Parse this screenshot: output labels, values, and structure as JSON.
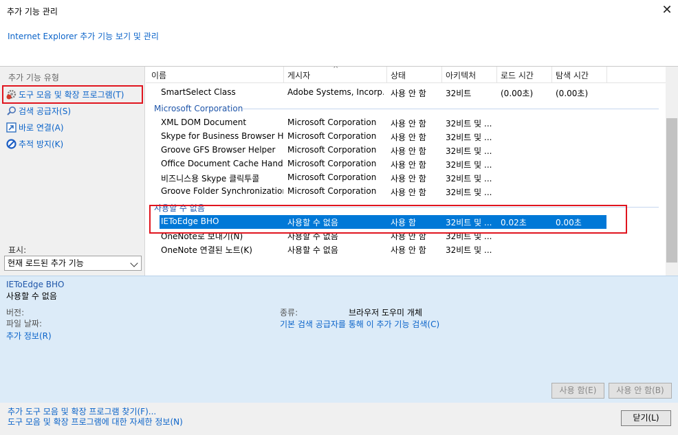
{
  "window": {
    "title": "추가 기능 관리",
    "subtitle": "Internet Explorer 추가 기능 보기 및 관리"
  },
  "left_pane": {
    "types_label": "추가 기능 유형",
    "items": [
      {
        "label": "도구 모음 및 확장 프로그램(T)",
        "icon": "gear-icon"
      },
      {
        "label": "검색 공급자(S)",
        "icon": "search-icon"
      },
      {
        "label": "바로 연결(A)",
        "icon": "accelerator-icon"
      },
      {
        "label": "추적 방지(K)",
        "icon": "block-icon"
      }
    ],
    "show_label": "표시:",
    "show_value": "현재 로드된 추가 기능"
  },
  "list": {
    "columns": [
      "이름",
      "게시자",
      "상태",
      "아키텍처",
      "로드 시간",
      "탐색 시간"
    ],
    "top_row": {
      "name": "SmartSelect Class",
      "publisher": "Adobe Systems, Incorp...",
      "status": "사용 안 함",
      "arch": "32비트",
      "load": "(0.00초)",
      "nav": "(0.00초)"
    },
    "group1": "Microsoft Corporation",
    "group1_rows": [
      {
        "name": "XML DOM Document",
        "publisher": "Microsoft Corporation",
        "status": "사용 안 함",
        "arch": "32비트 및 ..."
      },
      {
        "name": "Skype for Business Browser He...",
        "publisher": "Microsoft Corporation",
        "status": "사용 안 함",
        "arch": "32비트 및 ..."
      },
      {
        "name": "Groove GFS Browser Helper",
        "publisher": "Microsoft Corporation",
        "status": "사용 안 함",
        "arch": "32비트 및 ..."
      },
      {
        "name": "Office Document Cache Handler",
        "publisher": "Microsoft Corporation",
        "status": "사용 안 함",
        "arch": "32비트 및 ..."
      },
      {
        "name": "비즈니스용 Skype 클릭투콜",
        "publisher": "Microsoft Corporation",
        "status": "사용 안 함",
        "arch": "32비트 및 ..."
      },
      {
        "name": "Groove Folder Synchronization",
        "publisher": "Microsoft Corporation",
        "status": "사용 안 함",
        "arch": "32비트 및 ..."
      }
    ],
    "group2": "사용할 수 없음",
    "group2_rows": [
      {
        "name": "IEToEdge BHO",
        "publisher": "사용할 수 없음",
        "status": "사용 함",
        "arch": "32비트 및 ...",
        "load": "0.02초",
        "nav": "0.00초"
      },
      {
        "name": "OneNote로 보내기(N)",
        "publisher": "사용할 수 없음",
        "status": "사용 안 함",
        "arch": "32비트 및 ..."
      },
      {
        "name": "OneNote 연결된 노트(K)",
        "publisher": "사용할 수 없음",
        "status": "사용 안 함",
        "arch": "32비트 및 ..."
      }
    ]
  },
  "details": {
    "name": "IEToEdge BHO",
    "status": "사용할 수 없음",
    "version_label": "버전:",
    "date_label": "파일 날짜:",
    "more_info": "추가 정보(R)",
    "type_label": "종류:",
    "type_value": "브라우저 도우미 개체",
    "search_link": "기본 검색 공급자를 통해 이 추가 기능 검색(C)",
    "enable_btn": "사용 함(E)",
    "disable_btn": "사용 안 함(B)"
  },
  "footer": {
    "find_link": "추가 도구 모음 및 확장 프로그램 찾기(F)...",
    "learn_link": "도구 모음 및 확장 프로그램에 대한 자세한 정보(N)",
    "close_btn": "닫기(L)"
  },
  "colors": {
    "accent": "#0078d7",
    "link": "#0a63c9",
    "highlight": "#e0141e",
    "details_bg": "#dcebf8"
  }
}
